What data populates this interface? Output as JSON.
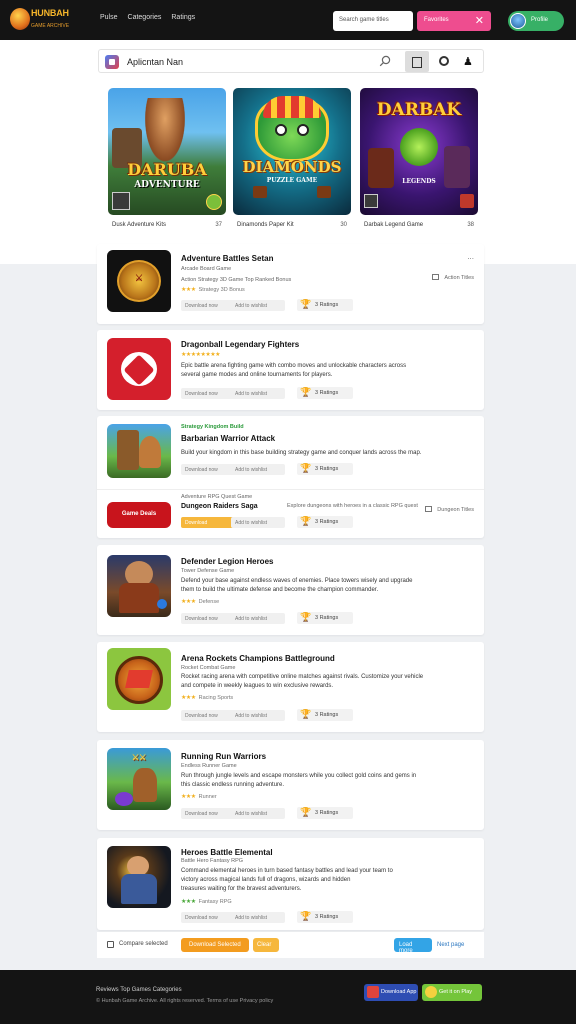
{
  "header": {
    "logo_text": "HUNBAH",
    "logo_sub": "GAME ARCHIVE",
    "nav": [
      "Pulse",
      "Categories",
      "Ratings"
    ],
    "search_placeholder": "Search game titles",
    "pink_button": "Favorites",
    "user_name": "Profile"
  },
  "search": {
    "value": "Aplicntan Nan"
  },
  "featured": [
    {
      "art_title": "DARUBA",
      "art_sub": "ADVENTURE",
      "caption": "Dusk Adventure Kits",
      "count": "37"
    },
    {
      "art_title": "DIAMONDS",
      "art_sub": "PUZZLE GAME",
      "caption": "Dinamonds Paper Kit",
      "count": "30"
    },
    {
      "art_title": "DARBAK",
      "art_sub": "LEGENDS",
      "caption": "Darbak Legend Game",
      "count": "38"
    }
  ],
  "cards": [
    {
      "title": "Adventure Battles Setan",
      "meta": "Arcade Board Game",
      "desc_lines": [
        "Action Strategy 3D Game Top Ranked Bonus"
      ],
      "stars": "★★★",
      "stars_note": "Strategy 3D Bonus",
      "tags": [
        "Download now",
        "Add to wishlist"
      ],
      "rating": "3 Ratings",
      "side": "Action Titles",
      "more": "..."
    },
    {
      "title": "Dragonball Legendary Fighters",
      "meta": "",
      "desc_lines": [
        "Epic battle arena fighting game with combo moves and unlockable characters across",
        "several game modes and online tournaments for players."
      ],
      "stars": "★★★★★★★★",
      "stars_note": "",
      "tags": [
        "Download now",
        "Add to wishlist"
      ],
      "rating": "3 Ratings",
      "side": ""
    },
    {
      "title": "Barbarian Warrior Attack",
      "meta": "Strategy Kingdom Build",
      "desc_lines": [
        "Build your kingdom in this base building strategy game and conquer lands across the map."
      ],
      "stars": "",
      "stars_note": "",
      "tags": [
        "Download now",
        "Add to wishlist"
      ],
      "rating": "3 Ratings",
      "side": ""
    },
    {
      "title": "Dungeon Raiders Saga",
      "meta": "Adventure RPG Quest Game",
      "desc_lines": [
        "Explore dungeons with heroes in a classic RPG quest"
      ],
      "stars": "",
      "stars_note": "",
      "tags": [
        "Download",
        "Add to wishlist"
      ],
      "rating": "3 Ratings",
      "side": "Dungeon Titles",
      "red_label": "Game Deals"
    },
    {
      "title": "Defender Legion Heroes",
      "meta": "Tower Defense Game",
      "desc_lines": [
        "Defend your base against endless waves of enemies. Place towers wisely and upgrade",
        "them to build the ultimate defense and become the champion commander."
      ],
      "stars": "★★★",
      "stars_note": "Defense",
      "tags": [
        "Download now",
        "Add to wishlist"
      ],
      "rating": "3 Ratings",
      "side": ""
    },
    {
      "title": "Arena Rockets Champions Battleground",
      "meta": "Rocket Combat Game",
      "desc_lines": [
        "Rocket racing arena with competitive online matches against rivals. Customize your vehicle",
        "and compete in weekly leagues to win exclusive rewards."
      ],
      "stars": "★★★",
      "stars_note": "Racing Sports",
      "tags": [
        "Download now",
        "Add to wishlist"
      ],
      "rating": "3 Ratings",
      "side": ""
    },
    {
      "title": "Running Run Warriors",
      "meta": "Endless Runner Game",
      "desc_lines": [
        "Run through jungle levels and escape monsters while you collect gold coins and gems in",
        "this classic endless running adventure."
      ],
      "stars": "★★★",
      "stars_note": "Runner",
      "tags": [
        "Download now",
        "Add to wishlist"
      ],
      "rating": "3 Ratings",
      "side": ""
    },
    {
      "title": "Heroes Battle Elemental",
      "meta": "Battle Hero  Fantasy RPG",
      "desc_lines": [
        "Command elemental heroes in turn based fantasy battles and lead your team to",
        "victory across magical lands full of dragons, wizards and hidden",
        "treasures waiting for the bravest adventurers."
      ],
      "stars": "★★★",
      "stars_note": "Fantasy RPG",
      "tags": [
        "Download now",
        "Add to wishlist"
      ],
      "rating": "3 Ratings",
      "side": ""
    }
  ],
  "bottom": {
    "checkbox_label": "Compare selected",
    "btn_primary": "Download Selected",
    "btn_secondary": "Clear",
    "btn_blue": "Load more",
    "link": "Next page"
  },
  "footer": {
    "line1": "Reviews  Top Games  Categories",
    "line2": "© Hunbah Game Archive. All rights reserved. Terms of use  Privacy policy",
    "store1": "Download App",
    "store2": "Get it on Play"
  },
  "colors": {
    "topbar": "#141414",
    "accent_pink": "#ee4d8f",
    "accent_green": "#37b066",
    "star": "#f2b01e"
  }
}
